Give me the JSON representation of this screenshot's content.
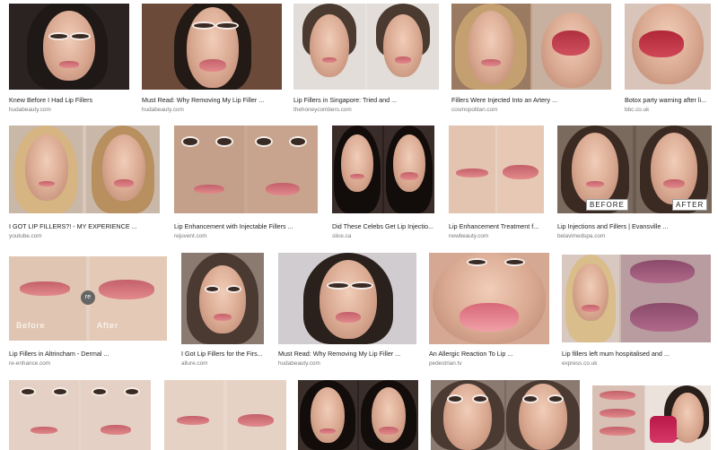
{
  "results": [
    {
      "title": "Knew Before I Had Lip Fillers",
      "source": "hudabeauty.com"
    },
    {
      "title": "Must Read: Why Removing My Lip Filler ...",
      "source": "hudabeauty.com"
    },
    {
      "title": "Lip Fillers in Singapore: Tried and ...",
      "source": "thehoneycombers.com"
    },
    {
      "title": "Fillers Were Injected Into an Artery ...",
      "source": "cosmopolitan.com"
    },
    {
      "title": "Botox party warning after li...",
      "source": "bbc.co.uk"
    },
    {
      "title": "I GOT LIP FILLERS?! - MY EXPERIENCE ...",
      "source": "youtube.com"
    },
    {
      "title": "Lip Enhancement with Injectable Fillers ...",
      "source": "rejuvent.com"
    },
    {
      "title": "Did These Celebs Get Lip Injectio...",
      "source": "slice.ca"
    },
    {
      "title": "Lip Enhancement Treatment f...",
      "source": "newbeauty.com"
    },
    {
      "title": "Lip Injections and Fillers | Evansville ...",
      "source": "belavimedspa.com",
      "labels": [
        "BEFORE",
        "AFTER"
      ]
    },
    {
      "title": "Lip Fillers in Altrincham - Dermal ...",
      "source": "re-enhance.com",
      "labels": [
        "Before",
        "After"
      ],
      "badge": "re"
    },
    {
      "title": "I Got Lip Fillers for the Firs...",
      "source": "allure.com"
    },
    {
      "title": "Must Read: Why Removing My Lip Filler ...",
      "source": "hudabeauty.com"
    },
    {
      "title": "An Allergic Reaction To Lip ...",
      "source": "pedestrian.tv"
    },
    {
      "title": "Lip fillers left mum hospitalised and ...",
      "source": "express.co.uk"
    },
    {
      "title": "",
      "source": ""
    },
    {
      "title": "",
      "source": ""
    },
    {
      "title": "",
      "source": ""
    },
    {
      "title": "",
      "source": ""
    },
    {
      "title": "",
      "source": ""
    }
  ]
}
